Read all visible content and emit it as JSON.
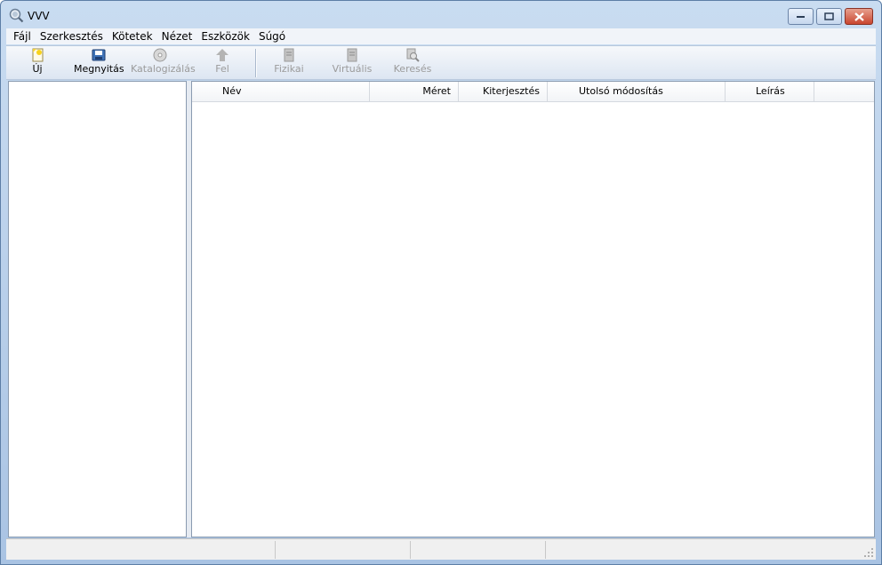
{
  "window": {
    "title": "VVV",
    "icon": "magnifier-globe-icon"
  },
  "menu": [
    {
      "label": "Fájl"
    },
    {
      "label": "Szerkesztés"
    },
    {
      "label": "Kötetek"
    },
    {
      "label": "Nézet"
    },
    {
      "label": "Eszközök"
    },
    {
      "label": "Súgó"
    }
  ],
  "toolbar": {
    "new": {
      "label": "Új",
      "icon": "new-document-icon",
      "enabled": true
    },
    "open": {
      "label": "Megnyitás",
      "icon": "open-floppy-icon",
      "enabled": true
    },
    "catalog": {
      "label": "Katalogizálás",
      "icon": "disc-icon",
      "enabled": false
    },
    "up": {
      "label": "Fel",
      "icon": "up-arrow-icon",
      "enabled": false
    },
    "physical": {
      "label": "Fizikai",
      "icon": "physical-view-icon",
      "enabled": false
    },
    "virtual": {
      "label": "Virtuális",
      "icon": "virtual-view-icon",
      "enabled": false
    },
    "search": {
      "label": "Keresés",
      "icon": "search-icon",
      "enabled": false
    }
  },
  "list": {
    "columns": [
      {
        "label": "Név"
      },
      {
        "label": "Méret"
      },
      {
        "label": "Kiterjesztés"
      },
      {
        "label": "Utolsó módosítás"
      },
      {
        "label": "Leírás"
      }
    ],
    "rows": []
  },
  "statusbar": {
    "panels": [
      "",
      "",
      "",
      ""
    ]
  },
  "colors": {
    "frame": "#a9c3e3",
    "close_button": "#c9452f",
    "disabled_text": "#9b9b9b"
  }
}
